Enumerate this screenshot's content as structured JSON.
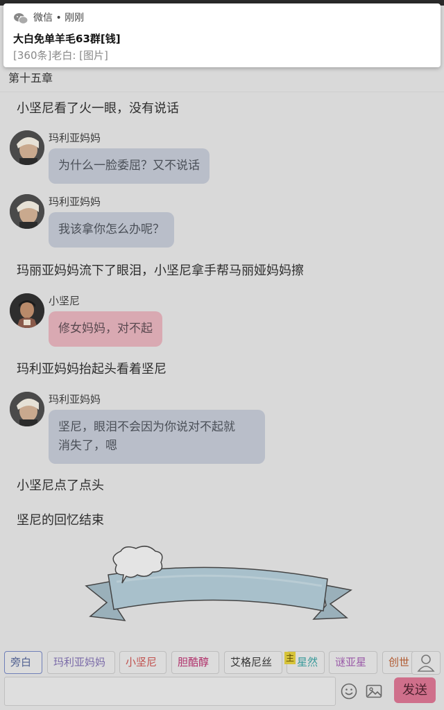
{
  "notification": {
    "app_line": "微信 • 刚刚",
    "title": "大白免单羊毛63群[钱]",
    "text": "[360条]老白: [图片]"
  },
  "chapter": {
    "title": "第十五章"
  },
  "messages": [
    {
      "type": "narration",
      "text": "小坚尼看了火一眼，没有说话"
    },
    {
      "type": "chat",
      "sender": "玛利亚妈妈",
      "text": "为什么一脸委屈？又不说话",
      "style": "gray"
    },
    {
      "type": "chat",
      "sender": "玛利亚妈妈",
      "text": "我该拿你怎么办呢？",
      "style": "gray"
    },
    {
      "type": "narration",
      "text": "玛丽亚妈妈流下了眼泪，小坚尼拿手帮马丽娅妈妈擦"
    },
    {
      "type": "chat",
      "sender": "小坚尼",
      "text": "修女妈妈，对不起",
      "style": "pink"
    },
    {
      "type": "narration",
      "text": "玛利亚妈妈抬起头看着坚尼"
    },
    {
      "type": "chat",
      "sender": "玛利亚妈妈",
      "text_line1": "坚尼，眼泪不会因为你说对不起就",
      "text_line2": "消失了，嗯",
      "style": "gray"
    },
    {
      "type": "narration",
      "text": "小坚尼点了点头"
    },
    {
      "type": "narration",
      "text": "坚尼的回忆结束"
    }
  ],
  "roles": [
    {
      "label": "旁白",
      "color": "#506090",
      "active": true
    },
    {
      "label": "玛利亚妈妈",
      "color": "#7a6aa8"
    },
    {
      "label": "小坚尼",
      "color": "#c0504d"
    },
    {
      "label": "胆酷醇",
      "color": "#b0306a"
    },
    {
      "label": "艾格尼丝",
      "color": "#333333"
    },
    {
      "label": "星然",
      "color": "#3a9a9a",
      "badge": "主"
    },
    {
      "label": "谜亚星",
      "color": "#9a5aa8"
    },
    {
      "label": "创世",
      "color": "#b05a30"
    }
  ],
  "composer": {
    "input_value": "",
    "send_label": "发送",
    "emoji_icon": "smiley-icon",
    "image_icon": "image-icon",
    "user_icon": "user-icon"
  },
  "colors": {
    "bubble_gray": "#b9bec9",
    "bubble_pink": "#d9a9b2",
    "send_button": "#cf6f8b",
    "overlay_dim": "#d9d9d9"
  }
}
